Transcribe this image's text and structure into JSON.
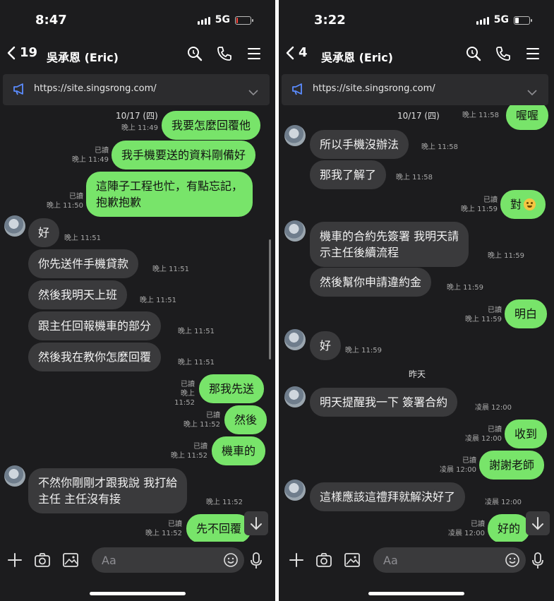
{
  "left": {
    "status_time": "8:47",
    "network": "5G",
    "battery_level": 0.08,
    "battery_color": "#ff453a",
    "back_count": "19",
    "contact_name": "吳承恩 (Eric)",
    "announcement_url": "https://site.singsrong.com/",
    "date_chip": "10/17 (四)",
    "input_placeholder": "Aa",
    "messages": [
      {
        "text": "我要怎麼回覆他",
        "meta": "晚上 11:49"
      },
      {
        "text": "我手機要送的資料剛備好",
        "read": "已讀",
        "meta": "晚上 11:49"
      },
      {
        "line1": "這陣子工程也忙，有點忘記，",
        "line2": "抱歉抱歉",
        "read": "已讀",
        "meta": "晚上 11:50"
      },
      {
        "text": "好",
        "meta": "晚上 11:51"
      },
      {
        "text": "你先送件手機貸款",
        "meta": "晚上 11:51"
      },
      {
        "text": "然後我明天上班",
        "meta": "晚上 11:51"
      },
      {
        "text": "跟主任回報機車的部分",
        "meta": "晚上 11:51"
      },
      {
        "text": "然後我在教你怎麼回覆",
        "meta": "晚上 11:51"
      },
      {
        "text": "那我先送",
        "read": "已讀",
        "meta": "晚上 11:52"
      },
      {
        "text": "然後",
        "read": "已讀",
        "meta": "晚上 11:52"
      },
      {
        "text": "機車的",
        "read": "已讀",
        "meta": "晚上 11:52"
      },
      {
        "line1": "不然你剛剛才跟我說 我打給",
        "line2": "主任 主任沒有接",
        "meta": "晚上 11:52"
      },
      {
        "text": "先不回覆",
        "read": "已讀",
        "meta": "晚上 11:52"
      }
    ]
  },
  "right": {
    "status_time": "3:22",
    "network": "5G",
    "battery_level": 0.3,
    "battery_color": "#ffffff",
    "back_count": "4",
    "contact_name": "吳承恩 (Eric)",
    "announcement_url": "https://site.singsrong.com/",
    "date_chip_1": "10/17 (四)",
    "date_chip_2": "昨天",
    "input_placeholder": "Aa",
    "messages": [
      {
        "text": "喔喔",
        "meta": "晚上 11:58"
      },
      {
        "text": "所以手機沒辦法",
        "meta": "晚上 11:58"
      },
      {
        "text": "那我了解了",
        "meta": "晚上 11:58"
      },
      {
        "text": "對",
        "read": "已讀",
        "meta": "晚上 11:59"
      },
      {
        "line1": "機車的合約先簽署 我明天請",
        "line2": "示主任後續流程",
        "meta": "晚上 11:59"
      },
      {
        "text": "然後幫你申請違約金",
        "meta": "晚上 11:59"
      },
      {
        "text": "明白",
        "read": "已讀",
        "meta": "晚上 11:59"
      },
      {
        "text": "好",
        "meta": "晚上 11:59"
      },
      {
        "text": "明天提醒我一下 簽署合約",
        "meta": "凌晨 12:00"
      },
      {
        "text": "收到",
        "read": "已讀",
        "meta": "凌晨 12:00"
      },
      {
        "text": "謝謝老師",
        "read": "已讀",
        "meta": "凌晨 12:00"
      },
      {
        "text": "這樣應該這禮拜就解決好了",
        "meta": "凌晨 12:00"
      },
      {
        "text": "好的",
        "read": "已讀",
        "meta": "凌晨 12:00"
      }
    ]
  }
}
